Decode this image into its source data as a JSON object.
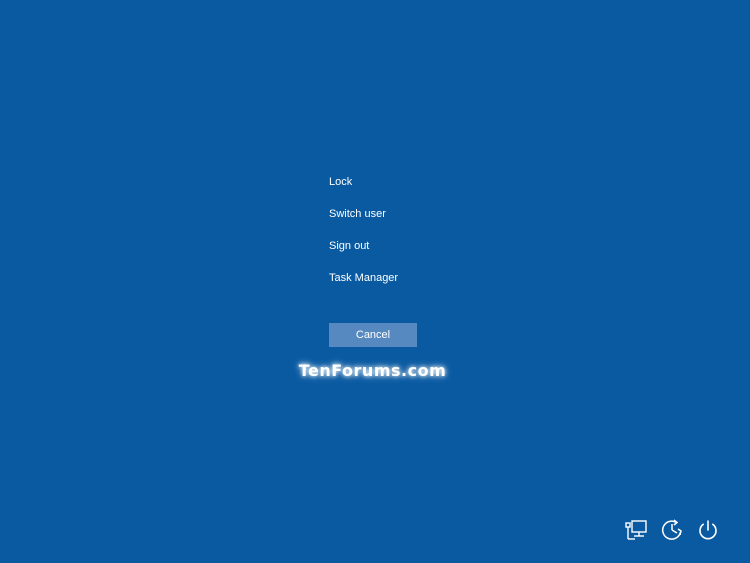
{
  "background_color": "#0a5aa2",
  "menu": {
    "items": [
      {
        "label": "Lock"
      },
      {
        "label": "Switch user"
      },
      {
        "label": "Sign out"
      },
      {
        "label": "Task Manager"
      }
    ]
  },
  "cancel_button": {
    "label": "Cancel",
    "color": "#5689bf"
  },
  "watermark": {
    "text": "TenForums.com"
  },
  "tray_icons": [
    {
      "icon": "network-icon"
    },
    {
      "icon": "ease-of-access-icon"
    },
    {
      "icon": "power-icon"
    }
  ]
}
